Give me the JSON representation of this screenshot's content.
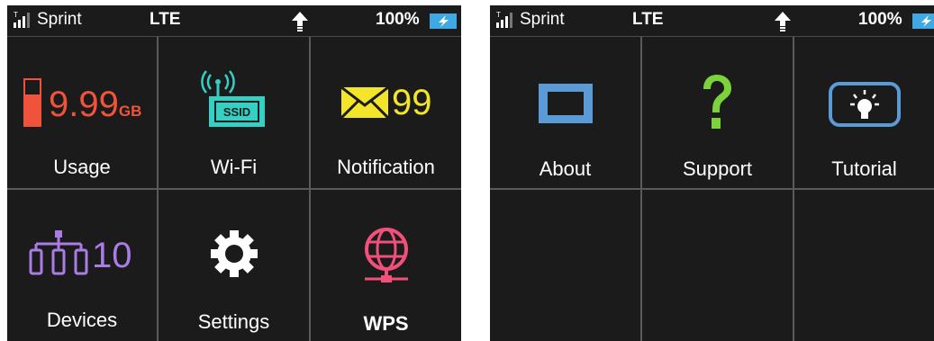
{
  "status_bar": {
    "carrier": "Sprint",
    "network": "LTE",
    "battery_percent": "100%",
    "icons": [
      "signal-icon",
      "data-transfer-icon",
      "battery-charging-icon"
    ]
  },
  "home_screen": {
    "tiles": [
      {
        "label": "Usage",
        "value": "9.99",
        "unit": "GB",
        "icon": "usage-meter-icon",
        "color": "#f0533c"
      },
      {
        "label": "Wi-Fi",
        "badge": "SSID",
        "icon": "wifi-ssid-icon",
        "color": "#35d0c4"
      },
      {
        "label": "Notification",
        "value": "99",
        "icon": "envelope-icon",
        "color": "#f2e52a"
      },
      {
        "label": "Devices",
        "value": "10",
        "icon": "devices-icon",
        "color": "#a97ce6"
      },
      {
        "label": "Settings",
        "icon": "gear-icon",
        "color": "#ffffff"
      },
      {
        "label": "WPS",
        "icon": "globe-network-icon",
        "color": "#f0507a"
      }
    ]
  },
  "more_screen": {
    "tiles": [
      {
        "label": "About",
        "icon": "about-screen-icon",
        "color": "#5b9bd5"
      },
      {
        "label": "Support",
        "icon": "question-mark-icon",
        "color": "#7bd23a"
      },
      {
        "label": "Tutorial",
        "icon": "lightbulb-icon",
        "color": "#5b9bd5"
      }
    ]
  }
}
